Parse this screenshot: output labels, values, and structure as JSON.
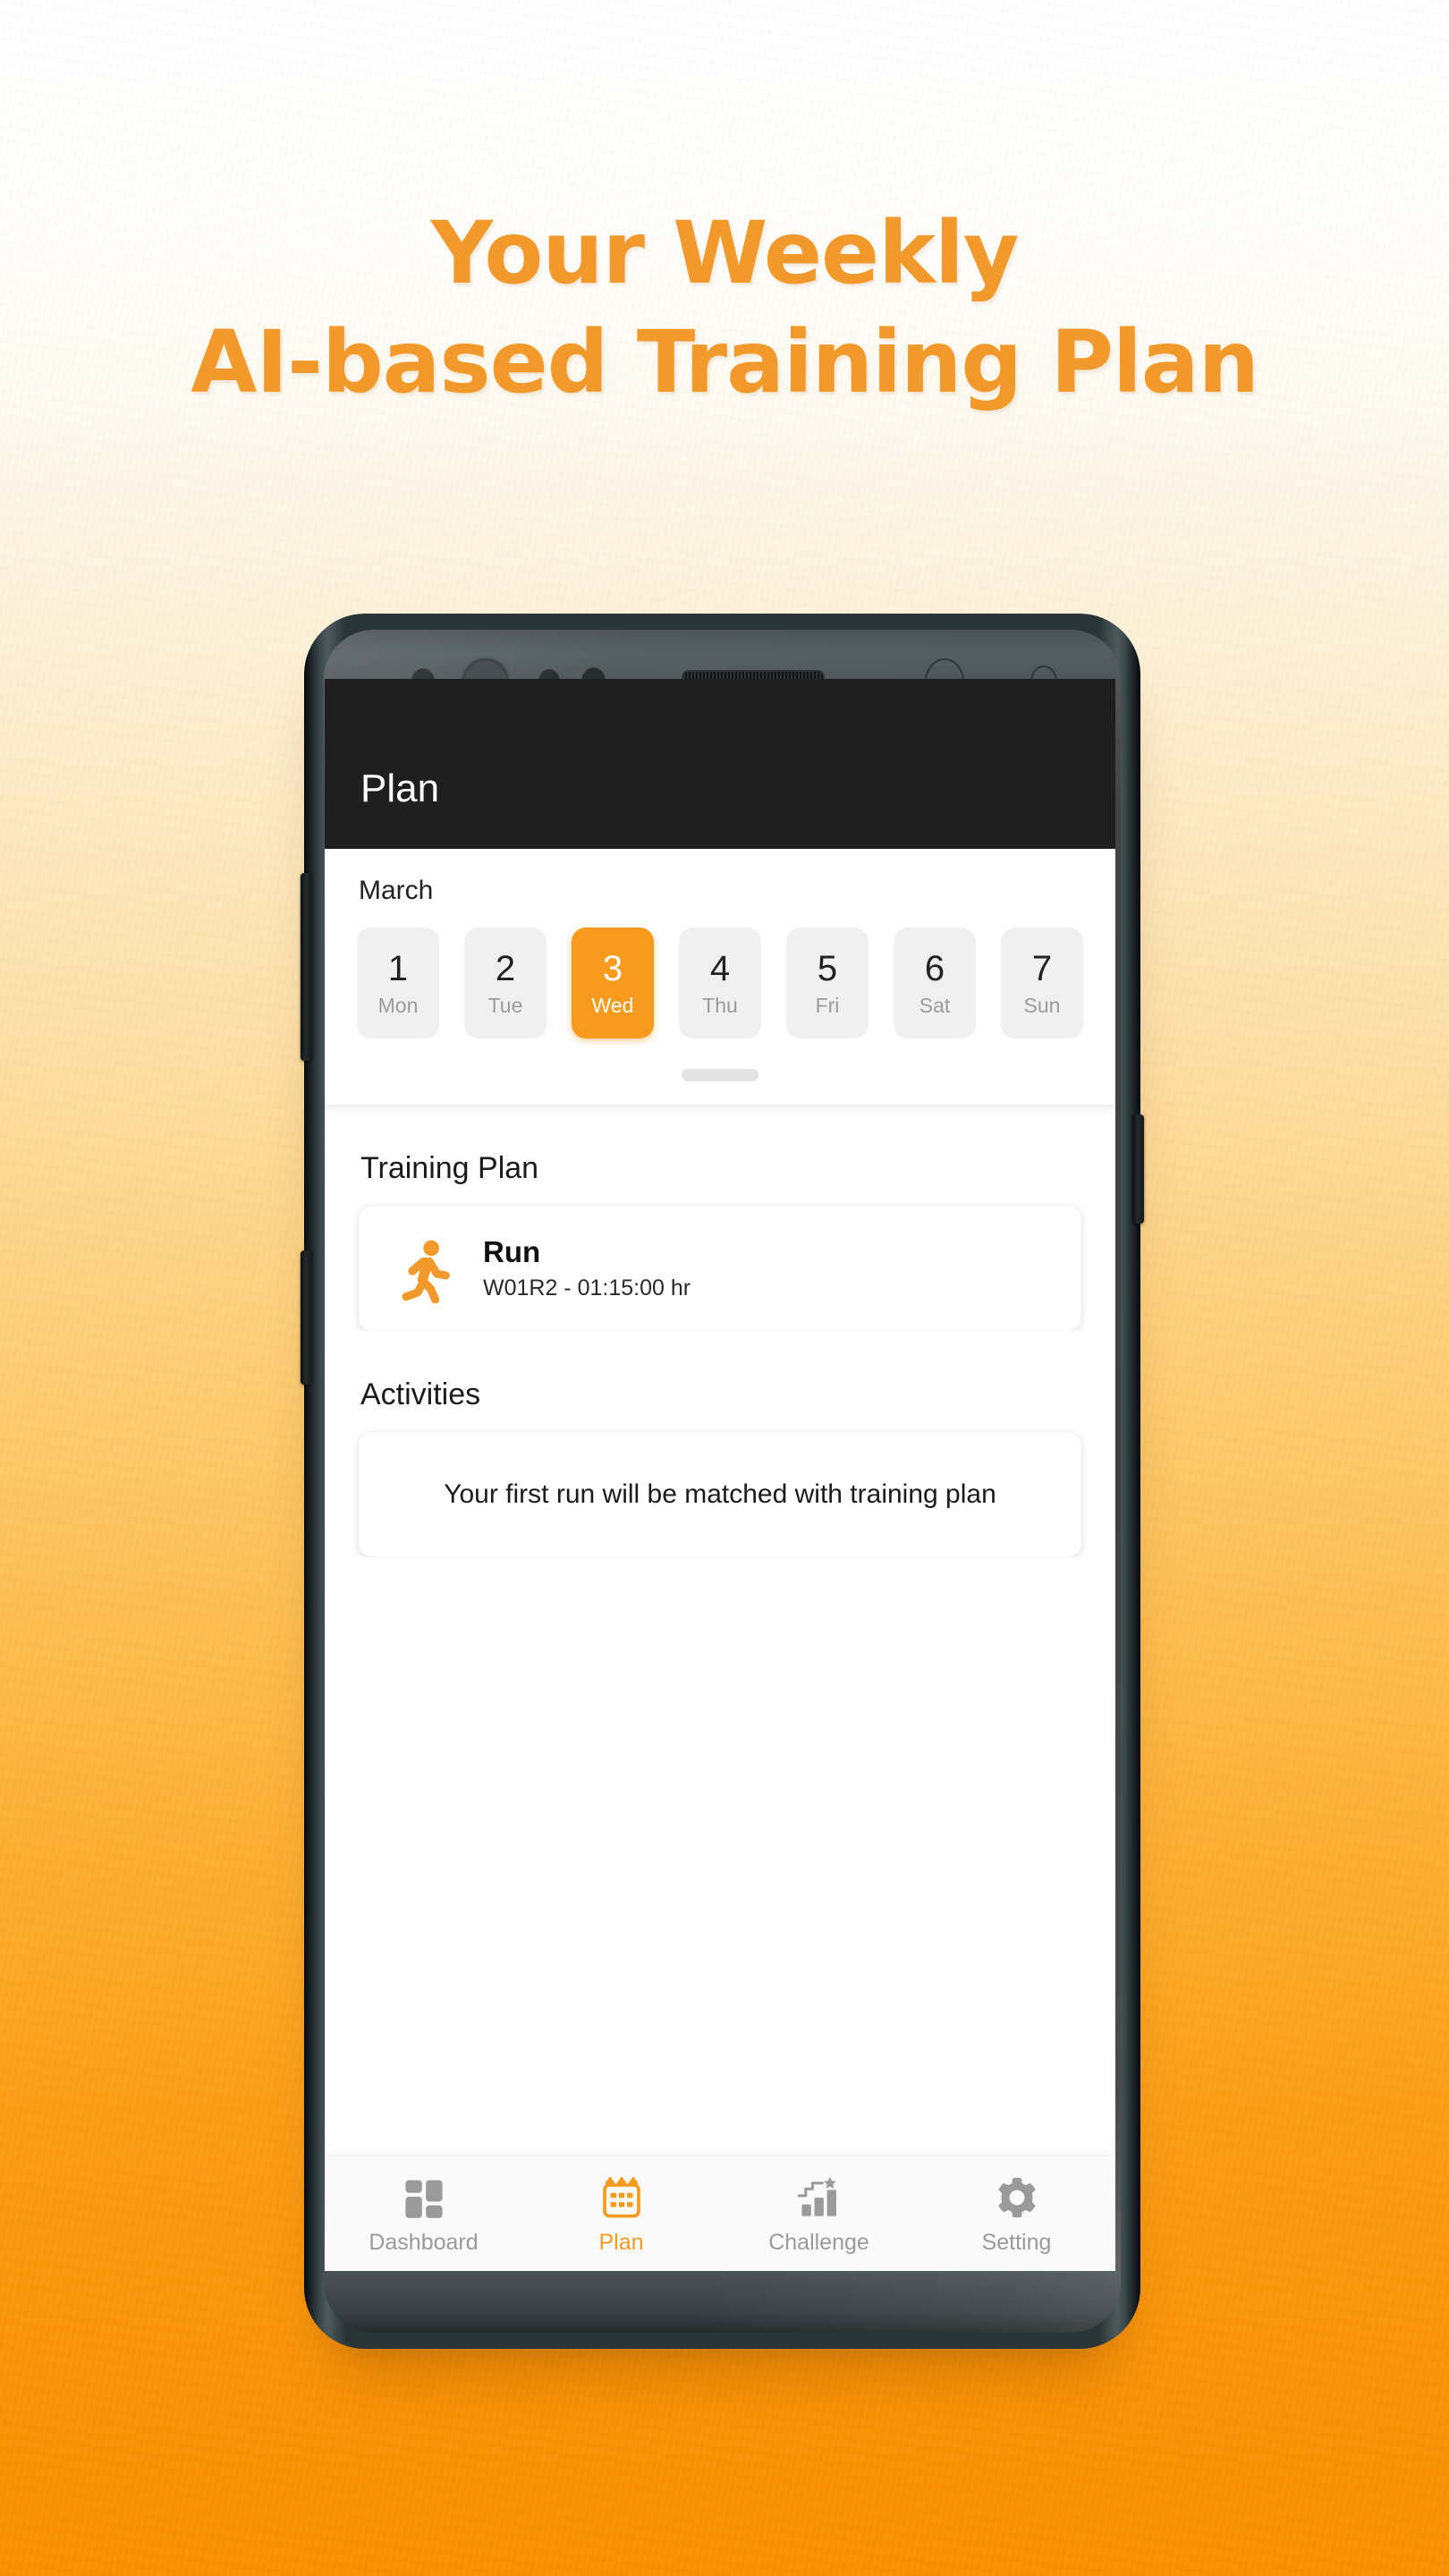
{
  "promo": {
    "headline_line1": "Your Weekly",
    "headline_line2": "AI-based Training Plan",
    "accent_color": "#F2992B"
  },
  "theme": {
    "accent": "#F79A1E",
    "appbar_bg": "#1F1F1F",
    "screen_bg": "#FFFFFF",
    "nav_bg": "#FAFAFA",
    "inactive_gray": "#9A9A9A",
    "chip_bg": "#F0F0F0",
    "bg_gradient_top": "#FFFFFF",
    "bg_gradient_bottom": "#F89000"
  },
  "app": {
    "appbar": {
      "title": "Plan"
    },
    "calendar": {
      "month": "March",
      "days": [
        {
          "num": "1",
          "label": "Mon",
          "selected": false
        },
        {
          "num": "2",
          "label": "Tue",
          "selected": false
        },
        {
          "num": "3",
          "label": "Wed",
          "selected": true
        },
        {
          "num": "4",
          "label": "Thu",
          "selected": false
        },
        {
          "num": "5",
          "label": "Fri",
          "selected": false
        },
        {
          "num": "6",
          "label": "Sat",
          "selected": false
        },
        {
          "num": "7",
          "label": "Sun",
          "selected": false
        }
      ],
      "drag_handle": "drag-handle"
    },
    "training_plan": {
      "section_title": "Training Plan",
      "item": {
        "icon": "running-figure-icon",
        "title": "Run",
        "subtitle": "W01R2 - 01:15:00 hr"
      }
    },
    "activities": {
      "section_title": "Activities",
      "empty_message": "Your first run will be matched with training plan"
    },
    "bottom_nav": {
      "items": [
        {
          "label": "Dashboard",
          "icon": "dashboard-grid-icon",
          "active": false
        },
        {
          "label": "Plan",
          "icon": "calendar-icon",
          "active": true
        },
        {
          "label": "Challenge",
          "icon": "bar-chart-star-icon",
          "active": false
        },
        {
          "label": "Setting",
          "icon": "gear-icon",
          "active": false
        }
      ]
    }
  },
  "device": {
    "hardware": [
      "proximity-sensor",
      "front-camera",
      "iris-sensor",
      "led-indicator",
      "earpiece-speaker",
      "volume-up-button",
      "volume-down-button",
      "power-button"
    ]
  }
}
